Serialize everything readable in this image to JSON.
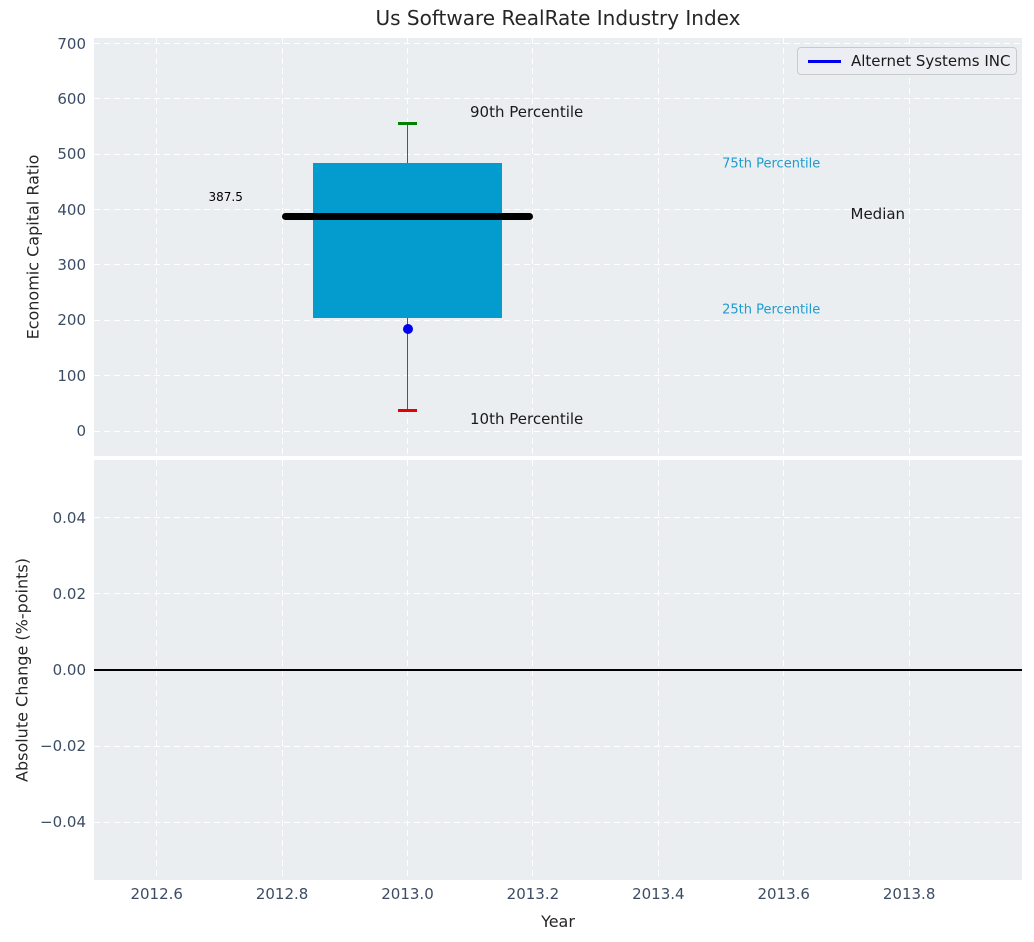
{
  "title": "Us Software RealRate Industry Index",
  "legend": {
    "label": "Alternet Systems INC",
    "line_color": "#0000f0"
  },
  "axes": {
    "top": {
      "ylabel": "Economic Capital Ratio"
    },
    "bottom": {
      "ylabel": "Absolute Change (%-points)",
      "xlabel": "Year"
    }
  },
  "colors": {
    "figure_bg": "#ffffff",
    "axes_bg": "#eaeef0",
    "grid": "#ffffff",
    "tick_label": "#3c4c64",
    "title_text": "#262626",
    "box_fill": "#049bce",
    "median_line": "#000000",
    "whisker": "#555555",
    "cap_90": "#008000",
    "cap_10": "#e60000",
    "company_dot": "#0000f0",
    "percentile_label": "#1f9ccf",
    "annotation_text": "#1a1a1a",
    "zero_line": "#000000"
  },
  "chart_data": [
    {
      "type": "box",
      "title": "Us Software RealRate Industry Index",
      "ylabel": "Economic Capital Ratio",
      "xlabel": "",
      "xlim": [
        2012.5,
        2013.98
      ],
      "ylim": [
        -45,
        710
      ],
      "yticks": [
        0,
        100,
        200,
        300,
        400,
        500,
        600,
        700
      ],
      "ytick_labels": [
        "0",
        "100",
        "200",
        "300",
        "400",
        "500",
        "600",
        "700"
      ],
      "xticks": [
        2012.6,
        2012.8,
        2013.0,
        2013.2,
        2013.4,
        2013.6,
        2013.8
      ],
      "grid": true,
      "legend_entries": [
        {
          "name": "Alternet Systems INC",
          "color": "#0000f0"
        }
      ],
      "legend_position": "upper right",
      "boxes": [
        {
          "x": 2013.0,
          "p10": 38,
          "p25": 205,
          "median": 387.5,
          "p75": 485,
          "p90": 555,
          "box_x": [
            2012.85,
            2013.15
          ],
          "median_x": [
            2012.8,
            2013.2
          ],
          "cap_halfwidth": 0.015,
          "series_point": {
            "name": "Alternet Systems INC",
            "x": 2013.0,
            "y": 185
          }
        }
      ],
      "annotations": [
        {
          "text": "387.5",
          "x": 2012.71,
          "y": 423,
          "size": 12,
          "color": "#000000"
        },
        {
          "text": "90th Percentile",
          "x": 2013.19,
          "y": 576,
          "size": 15,
          "color": "#1a1a1a"
        },
        {
          "text": "10th Percentile",
          "x": 2013.19,
          "y": 22,
          "size": 15,
          "color": "#1a1a1a"
        },
        {
          "text": "75th Percentile",
          "x": 2013.58,
          "y": 482,
          "size": 13,
          "color": "#1f9ccf"
        },
        {
          "text": "25th Percentile",
          "x": 2013.58,
          "y": 219,
          "size": 13,
          "color": "#1f9ccf"
        },
        {
          "text": "Median",
          "x": 2013.75,
          "y": 392,
          "size": 15,
          "color": "#1a1a1a"
        }
      ]
    },
    {
      "type": "line",
      "title": "",
      "ylabel": "Absolute Change (%-points)",
      "xlabel": "Year",
      "xlim": [
        2012.5,
        2013.98
      ],
      "ylim": [
        -0.0552,
        0.0552
      ],
      "yticks": [
        0.04,
        0.02,
        0.0,
        -0.02,
        -0.04
      ],
      "ytick_labels": [
        "0.04",
        "0.02",
        "0.00",
        "−0.02",
        "−0.04"
      ],
      "xticks": [
        2012.6,
        2012.8,
        2013.0,
        2013.2,
        2013.4,
        2013.6,
        2013.8
      ],
      "xtick_labels": [
        "2012.6",
        "2012.8",
        "2013.0",
        "2013.2",
        "2013.4",
        "2013.6",
        "2013.8"
      ],
      "grid": true,
      "zero_line": 0.0,
      "series": [
        {
          "name": "Alternet Systems INC",
          "x": [
            2013.0
          ],
          "y": [
            0.0
          ],
          "visible_points": 0
        }
      ]
    }
  ]
}
